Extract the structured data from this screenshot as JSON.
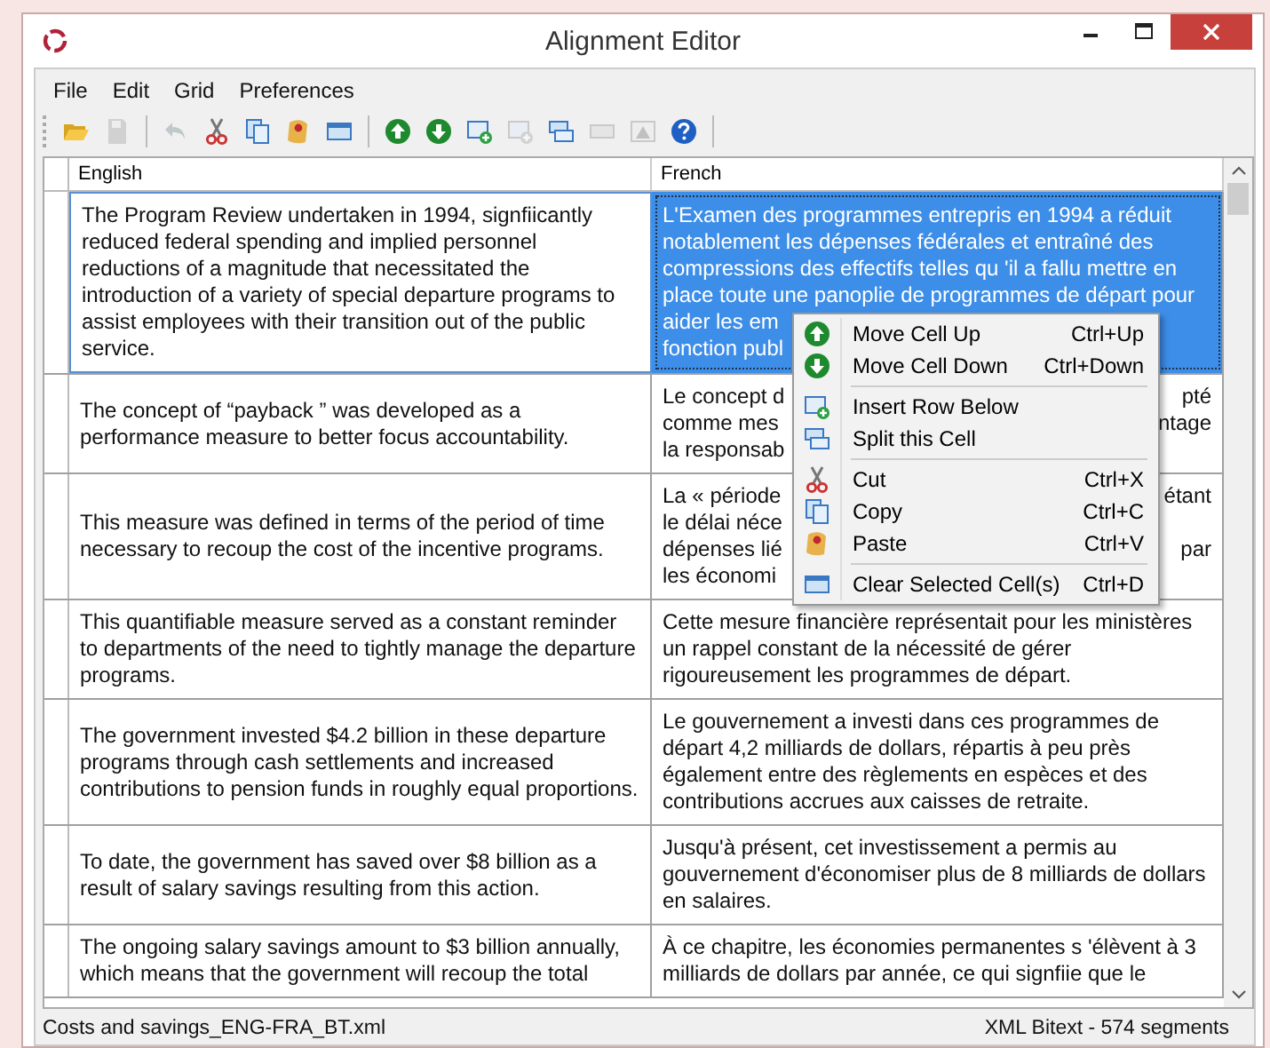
{
  "window": {
    "title": "Alignment Editor"
  },
  "menu_bar": [
    "File",
    "Edit",
    "Grid",
    "Preferences"
  ],
  "toolbar": [
    {
      "kind": "open",
      "disabled": false
    },
    {
      "kind": "save",
      "disabled": true
    },
    {
      "kind": "sep"
    },
    {
      "kind": "undo",
      "disabled": true
    },
    {
      "kind": "cut",
      "disabled": false
    },
    {
      "kind": "copy",
      "disabled": false
    },
    {
      "kind": "paste",
      "disabled": false
    },
    {
      "kind": "clear",
      "disabled": false
    },
    {
      "kind": "sep"
    },
    {
      "kind": "up",
      "disabled": false
    },
    {
      "kind": "down",
      "disabled": false
    },
    {
      "kind": "insert",
      "disabled": false
    },
    {
      "kind": "delete",
      "disabled": true
    },
    {
      "kind": "split",
      "disabled": false
    },
    {
      "kind": "merge",
      "disabled": true
    },
    {
      "kind": "warning",
      "disabled": true
    },
    {
      "kind": "help",
      "disabled": false
    },
    {
      "kind": "sep"
    }
  ],
  "table": {
    "columns": [
      "English",
      "French"
    ],
    "rows": [
      {
        "english": "The Program Review undertaken in 1994, signfiicantly reduced federal spending and implied personnel reductions of a magnitude that necessitated the introduction of a variety of special departure programs to assist employees with their transition out of the public service.",
        "french": {
          "selected": true,
          "lines": [
            {
              "left": "L'Examen des programmes entrepris en 1994 a réduit"
            },
            {
              "left": "notablement les dépenses fédérales et entraîné des"
            },
            {
              "left": "compressions des effectifs telles qu 'il a fallu mettre en"
            },
            {
              "left": "place toute une panoplie de programmes de départ pour"
            },
            {
              "left": "aider les em"
            },
            {
              "left": "fonction publ"
            }
          ]
        }
      },
      {
        "english": "The concept of “payback ” was developed as a performance measure to better focus accountability.",
        "french": {
          "selected": false,
          "lines": [
            {
              "left": "Le concept d",
              "right": "pté"
            },
            {
              "left": "comme mes",
              "right": "ntage"
            },
            {
              "left": "la responsab"
            }
          ]
        }
      },
      {
        "english": "This measure was defined in terms of the period of time necessary to recoup the cost of the incentive programs.",
        "french": {
          "selected": false,
          "lines": [
            {
              "left": "La « période",
              "right": "étant"
            },
            {
              "left": "le délai néce"
            },
            {
              "left": "dépenses lié",
              "right": "par"
            },
            {
              "left": "les économi"
            }
          ]
        }
      },
      {
        "english": "This quantifiable measure served as a constant reminder to departments of the need to tightly manage the departure programs.",
        "french": {
          "selected": false,
          "text": "Cette mesure financière représentait pour les ministères un rappel constant de la nécessité de gérer rigoureusement les programmes de départ."
        }
      },
      {
        "english": "The government invested $4.2 billion in these departure programs through cash settlements and increased contributions to pension funds in roughly equal proportions.",
        "french": {
          "selected": false,
          "text": "Le gouvernement a investi dans ces programmes de départ 4,2 milliards de dollars, répartis à peu près également entre des règlements en espèces et des contributions accrues aux caisses de retraite."
        }
      },
      {
        "english": "To date, the government has saved over $8 billion as a result of salary savings resulting from this action.",
        "french": {
          "selected": false,
          "text": "Jusqu'à présent, cet investissement a permis au gouvernement d'économiser plus de 8 milliards de dollars en salaires."
        }
      },
      {
        "english": "The ongoing salary savings amount to $3 billion annually, which means that the government will recoup the total",
        "french": {
          "selected": false,
          "text": "À ce chapitre, les économies permanentes s 'élèvent à 3 milliards de dollars par année, ce qui signfiie que le"
        }
      }
    ]
  },
  "context_menu": [
    {
      "kind": "up",
      "label": "Move Cell Up",
      "shortcut": "Ctrl+Up"
    },
    {
      "kind": "down",
      "label": "Move Cell Down",
      "shortcut": "Ctrl+Down"
    },
    {
      "kind": "separator"
    },
    {
      "kind": "insert",
      "label": "Insert Row Below"
    },
    {
      "kind": "split",
      "label": "Split this Cell"
    },
    {
      "kind": "separator"
    },
    {
      "kind": "cut",
      "label": "Cut",
      "shortcut": "Ctrl+X"
    },
    {
      "kind": "copy",
      "label": "Copy",
      "shortcut": "Ctrl+C"
    },
    {
      "kind": "paste",
      "label": "Paste",
      "shortcut": "Ctrl+V"
    },
    {
      "kind": "separator"
    },
    {
      "kind": "clear",
      "label": "Clear Selected Cell(s)",
      "shortcut": "Ctrl+D"
    }
  ],
  "status_bar": {
    "file": "Costs and savings_ENG-FRA_BT.xml",
    "info": "XML Bitext - 574 segments"
  }
}
